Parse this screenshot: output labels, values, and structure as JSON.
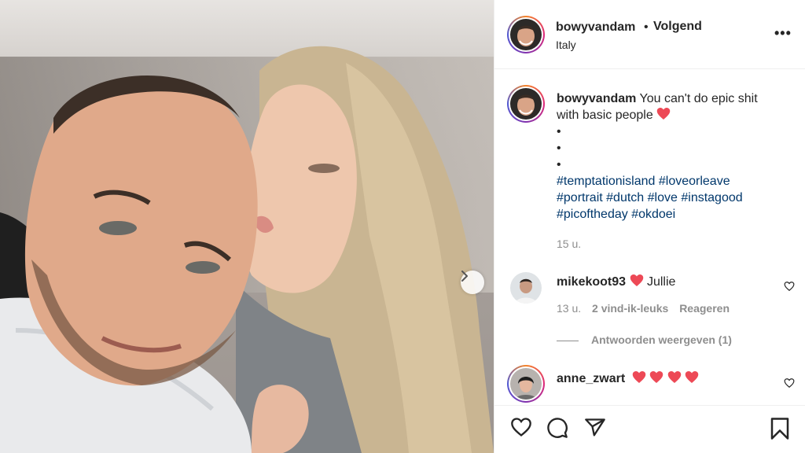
{
  "post": {
    "username": "bowyvandam",
    "separator": "•",
    "follow_status": "Volgend",
    "location": "Italy",
    "more_label": "•••"
  },
  "caption": {
    "username": "bowyvandam",
    "text_line1": "You can't do epic shit",
    "text_line2": "with basic people",
    "dots": [
      "•",
      "•",
      "•"
    ],
    "hashtags_line1": [
      "#temptationisland",
      "#loveorleave"
    ],
    "hashtags_line2": [
      "#portrait",
      "#dutch",
      "#love",
      "#instagood"
    ],
    "hashtags_line3": [
      "#picoftheday",
      "#okdoei"
    ],
    "time": "15 u."
  },
  "comments": [
    {
      "username": "mikekoot93",
      "text": "Jullie",
      "time": "13 u.",
      "likes": "2 vind-ik-leuks",
      "reply_label": "Reageren",
      "view_replies": "Antwoorden weergeven (1)"
    },
    {
      "username": "anne_zwart",
      "hearts": 4
    }
  ],
  "colors": {
    "heart": "#ed4956",
    "hashtag": "#00376b",
    "muted": "#8e8e8e"
  },
  "icons": [
    "like-icon",
    "comment-icon",
    "share-icon",
    "bookmark-icon",
    "next-arrow-icon",
    "more-options-icon"
  ]
}
